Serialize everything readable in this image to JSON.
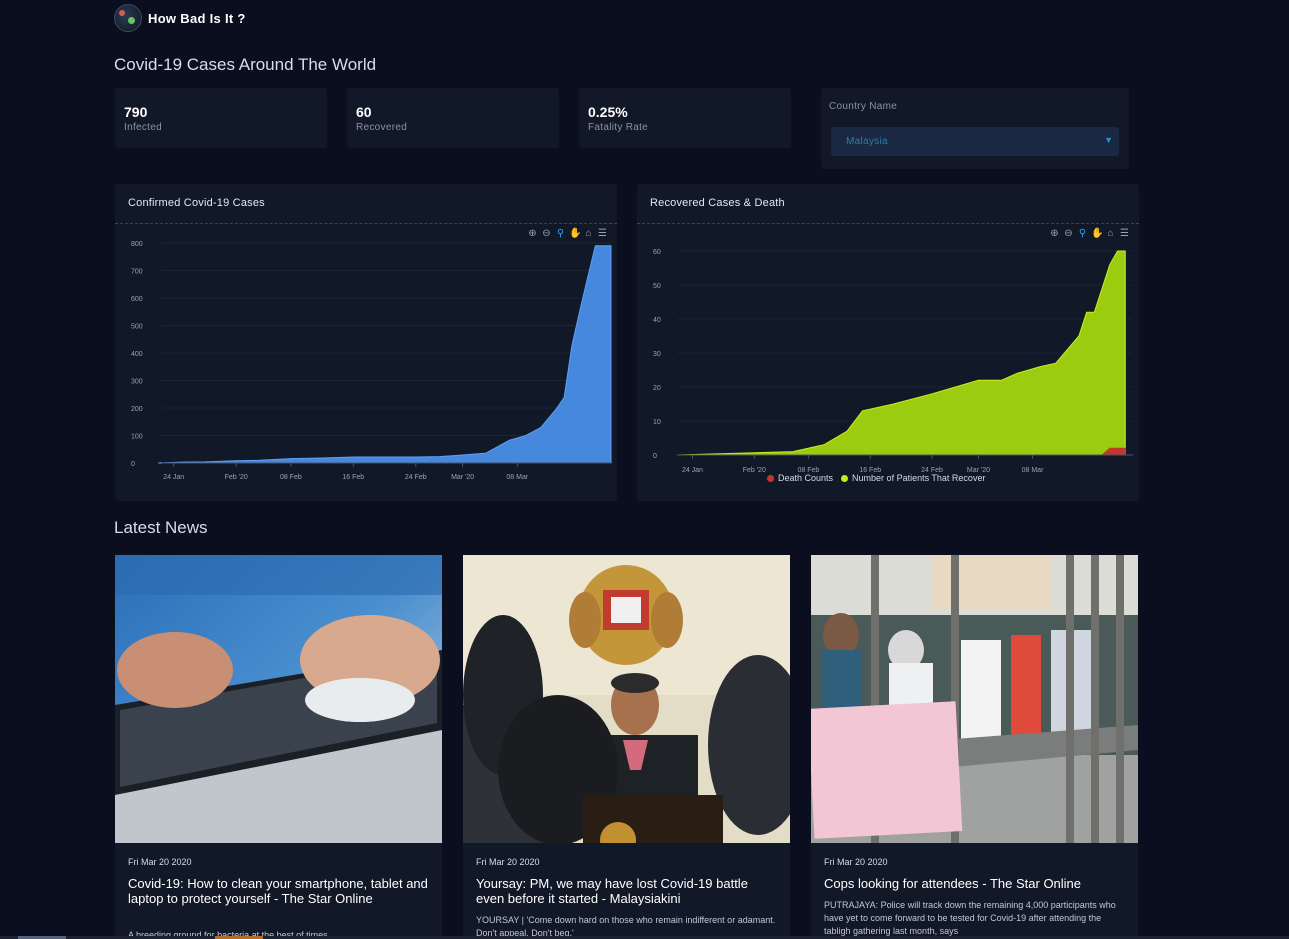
{
  "brand": {
    "name": "How Bad Is It ?"
  },
  "world_title": "Covid-19 Cases Around The World",
  "stats": [
    {
      "value": "790",
      "label": "Infected"
    },
    {
      "value": "60",
      "label": "Recovered"
    },
    {
      "value": "0.25%",
      "label": "Fatality Rate"
    }
  ],
  "country": {
    "label": "Country Name",
    "selected": "Malaysia"
  },
  "charts": {
    "confirmed": {
      "title": "Confirmed Covid-19 Cases"
    },
    "recovered": {
      "title": "Recovered Cases & Death",
      "legend": [
        {
          "name": "Death Counts",
          "color": "#c0392b"
        },
        {
          "name": "Number of Patients That Recover",
          "color": "#c6ee1a"
        }
      ]
    }
  },
  "chart_data": [
    {
      "type": "area",
      "title": "Confirmed Covid-19 Cases",
      "color": "#4a8ee8",
      "ylim": [
        0,
        800
      ],
      "yticks": [
        0,
        100,
        200,
        300,
        400,
        500,
        600,
        700,
        800
      ],
      "xticks": [
        "24 Jan",
        "Feb '20",
        "08 Feb",
        "16 Feb",
        "24 Feb",
        "Mar '20",
        "08 Mar"
      ],
      "x": [
        "2020-01-22",
        "2020-01-25",
        "2020-01-28",
        "2020-02-01",
        "2020-02-04",
        "2020-02-08",
        "2020-02-12",
        "2020-02-16",
        "2020-02-20",
        "2020-02-24",
        "2020-02-27",
        "2020-03-01",
        "2020-03-04",
        "2020-03-07",
        "2020-03-09",
        "2020-03-11",
        "2020-03-13",
        "2020-03-14",
        "2020-03-15",
        "2020-03-16",
        "2020-03-17",
        "2020-03-18",
        "2020-03-19",
        "2020-03-20"
      ],
      "values": [
        0,
        3,
        4,
        8,
        10,
        16,
        18,
        22,
        22,
        22,
        23,
        29,
        36,
        83,
        99,
        129,
        197,
        238,
        428,
        553,
        673,
        790,
        790,
        790
      ]
    },
    {
      "type": "area",
      "title": "Recovered Cases & Death",
      "ylim": [
        0,
        60
      ],
      "yticks": [
        0,
        10,
        20,
        30,
        40,
        50,
        60
      ],
      "xticks": [
        "24 Jan",
        "Feb '20",
        "08 Feb",
        "16 Feb",
        "24 Feb",
        "Mar '20",
        "08 Mar"
      ],
      "series": [
        {
          "name": "Number of Patients That Recover",
          "color": "#9ccc10",
          "x": [
            "2020-01-22",
            "2020-02-06",
            "2020-02-10",
            "2020-02-13",
            "2020-02-15",
            "2020-02-19",
            "2020-02-24",
            "2020-03-01",
            "2020-03-04",
            "2020-03-06",
            "2020-03-09",
            "2020-03-11",
            "2020-03-14",
            "2020-03-15",
            "2020-03-16",
            "2020-03-17",
            "2020-03-18",
            "2020-03-19",
            "2020-03-20"
          ],
          "values": [
            0,
            1,
            3,
            7,
            13,
            15,
            18,
            22,
            22,
            24,
            26,
            27,
            35,
            42,
            42,
            49,
            56,
            60,
            60
          ]
        },
        {
          "name": "Death Counts",
          "color": "#c0392b",
          "x": [
            "2020-01-22",
            "2020-03-17",
            "2020-03-18",
            "2020-03-20"
          ],
          "values": [
            0,
            0,
            2,
            2
          ]
        }
      ]
    }
  ],
  "news_title": "Latest News",
  "news": [
    {
      "date": "Fri Mar 20 2020",
      "title": "Covid-19: How to clean your smartphone, tablet and laptop to protect yourself - The Star Online",
      "desc": "A breeding ground for bacteria at the best of times..."
    },
    {
      "date": "Fri Mar 20 2020",
      "title": "Yoursay: PM, we may have lost Covid-19 battle even before it started - Malaysiakini",
      "desc": "YOURSAY | 'Come down hard on those who remain indifferent or adamant. Don't appeal. Don't beg.'"
    },
    {
      "date": "Fri Mar 20 2020",
      "title": "Cops looking for attendees - The Star Online",
      "desc": "PUTRAJAYA: Police will track down the remaining 4,000 participants who have yet to come forward to be tested for Covid-19 after attending the tabligh gathering last month, says"
    }
  ]
}
